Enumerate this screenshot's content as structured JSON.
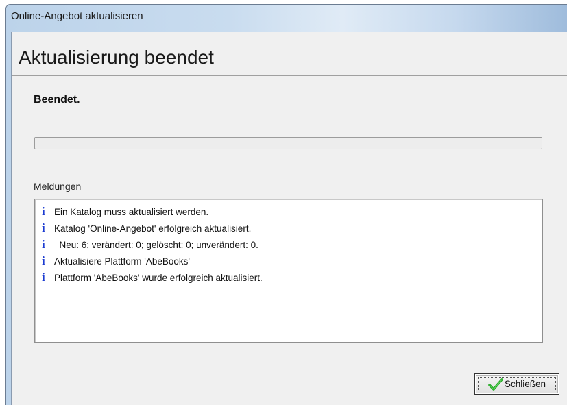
{
  "window": {
    "title": "Online-Angebot aktualisieren"
  },
  "header": {
    "heading": "Aktualisierung beendet"
  },
  "status": {
    "text": "Beendet.",
    "progress_percent": 0
  },
  "messages": {
    "label": "Meldungen",
    "items": [
      {
        "icon": "info-icon",
        "glyph": "i",
        "text": "Ein Katalog muss aktualisiert werden."
      },
      {
        "icon": "info-icon",
        "glyph": "i",
        "text": "Katalog 'Online-Angebot' erfolgreich aktualisiert."
      },
      {
        "icon": "info-icon",
        "glyph": "i",
        "text": "  Neu: 6; verändert: 0; gelöscht: 0; unverändert: 0."
      },
      {
        "icon": "info-icon",
        "glyph": "i",
        "text": "Aktualisiere Plattform 'AbeBooks'"
      },
      {
        "icon": "info-icon",
        "glyph": "i",
        "text": "Plattform 'AbeBooks' wurde erfolgreich aktualisiert."
      }
    ]
  },
  "footer": {
    "close_label": "Schließen",
    "close_icon": "checkmark-icon"
  },
  "colors": {
    "info_icon": "#1b3bd1",
    "check_icon": "#22a822",
    "client_bg": "#f0f0f0"
  }
}
